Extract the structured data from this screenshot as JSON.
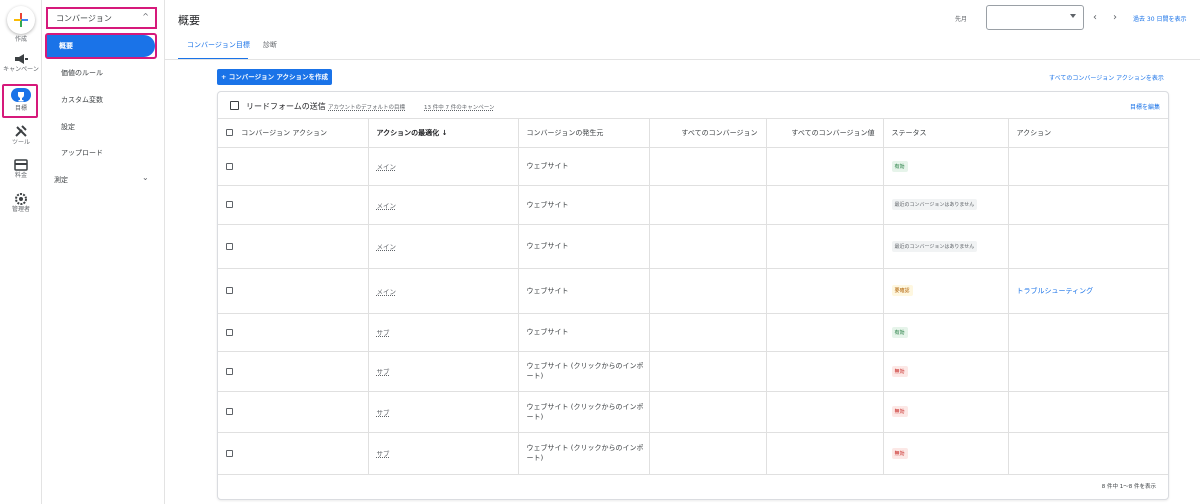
{
  "rail": {
    "create_label": "作成",
    "campaigns_label": "キャンペーン",
    "goals_label": "目標",
    "tools_label": "ツール",
    "billing_label": "料金",
    "admin_label": "管理者"
  },
  "subnav": {
    "section": "コンバージョン",
    "items": [
      "概要",
      "価値のルール",
      "カスタム変数",
      "設定",
      "アップロード"
    ],
    "measure": "測定"
  },
  "header": {
    "title": "概要",
    "date_label": "先月",
    "past_link": "過去 30 日間を表示"
  },
  "tabs": [
    "コンバージョン目標",
    "診断"
  ],
  "create_button": "+ コンバージョン アクションを作成",
  "show_all_link": "すべてのコンバージョン アクションを表示",
  "card": {
    "title": "リードフォームの送信",
    "meta1": "アカウントのデフォルトの目標",
    "meta2": "13 件中 7 件のキャンペーン",
    "edit_goal": "目標を編集",
    "footer": "8 件中 1～8 件を表示"
  },
  "table": {
    "headers": [
      "コンバージョン アクション",
      "アクションの最適化 ↓",
      "コンバージョンの発生元",
      "すべてのコンバージョン",
      "すべてのコンバージョン値",
      "ステータス",
      "アクション"
    ],
    "rows": [
      {
        "opt": "メイン",
        "source": "ウェブサイト",
        "status": "有効",
        "status_kind": "active",
        "action": ""
      },
      {
        "opt": "メイン",
        "source": "ウェブサイト",
        "status": "最近のコンバージョンはありません",
        "status_kind": "none",
        "action": ""
      },
      {
        "opt": "メイン",
        "source": "ウェブサイト",
        "status": "最近のコンバージョンはありません",
        "status_kind": "none",
        "action": ""
      },
      {
        "opt": "メイン",
        "source": "ウェブサイト",
        "status": "要確認",
        "status_kind": "attn",
        "action": "トラブルシューティング"
      },
      {
        "opt": "サブ",
        "source": "ウェブサイト",
        "status": "有効",
        "status_kind": "active",
        "action": ""
      },
      {
        "opt": "サブ",
        "source": "ウェブサイト (クリックからのインポート)",
        "status": "無効",
        "status_kind": "inactive",
        "action": ""
      },
      {
        "opt": "サブ",
        "source": "ウェブサイト (クリックからのインポート)",
        "status": "無効",
        "status_kind": "inactive",
        "action": ""
      },
      {
        "opt": "サブ",
        "source": "ウェブサイト (クリックからのインポート)",
        "status": "無効",
        "status_kind": "inactive",
        "action": ""
      }
    ]
  },
  "colors": {
    "accent": "#1a73e8",
    "highlight": "#d6197b"
  }
}
